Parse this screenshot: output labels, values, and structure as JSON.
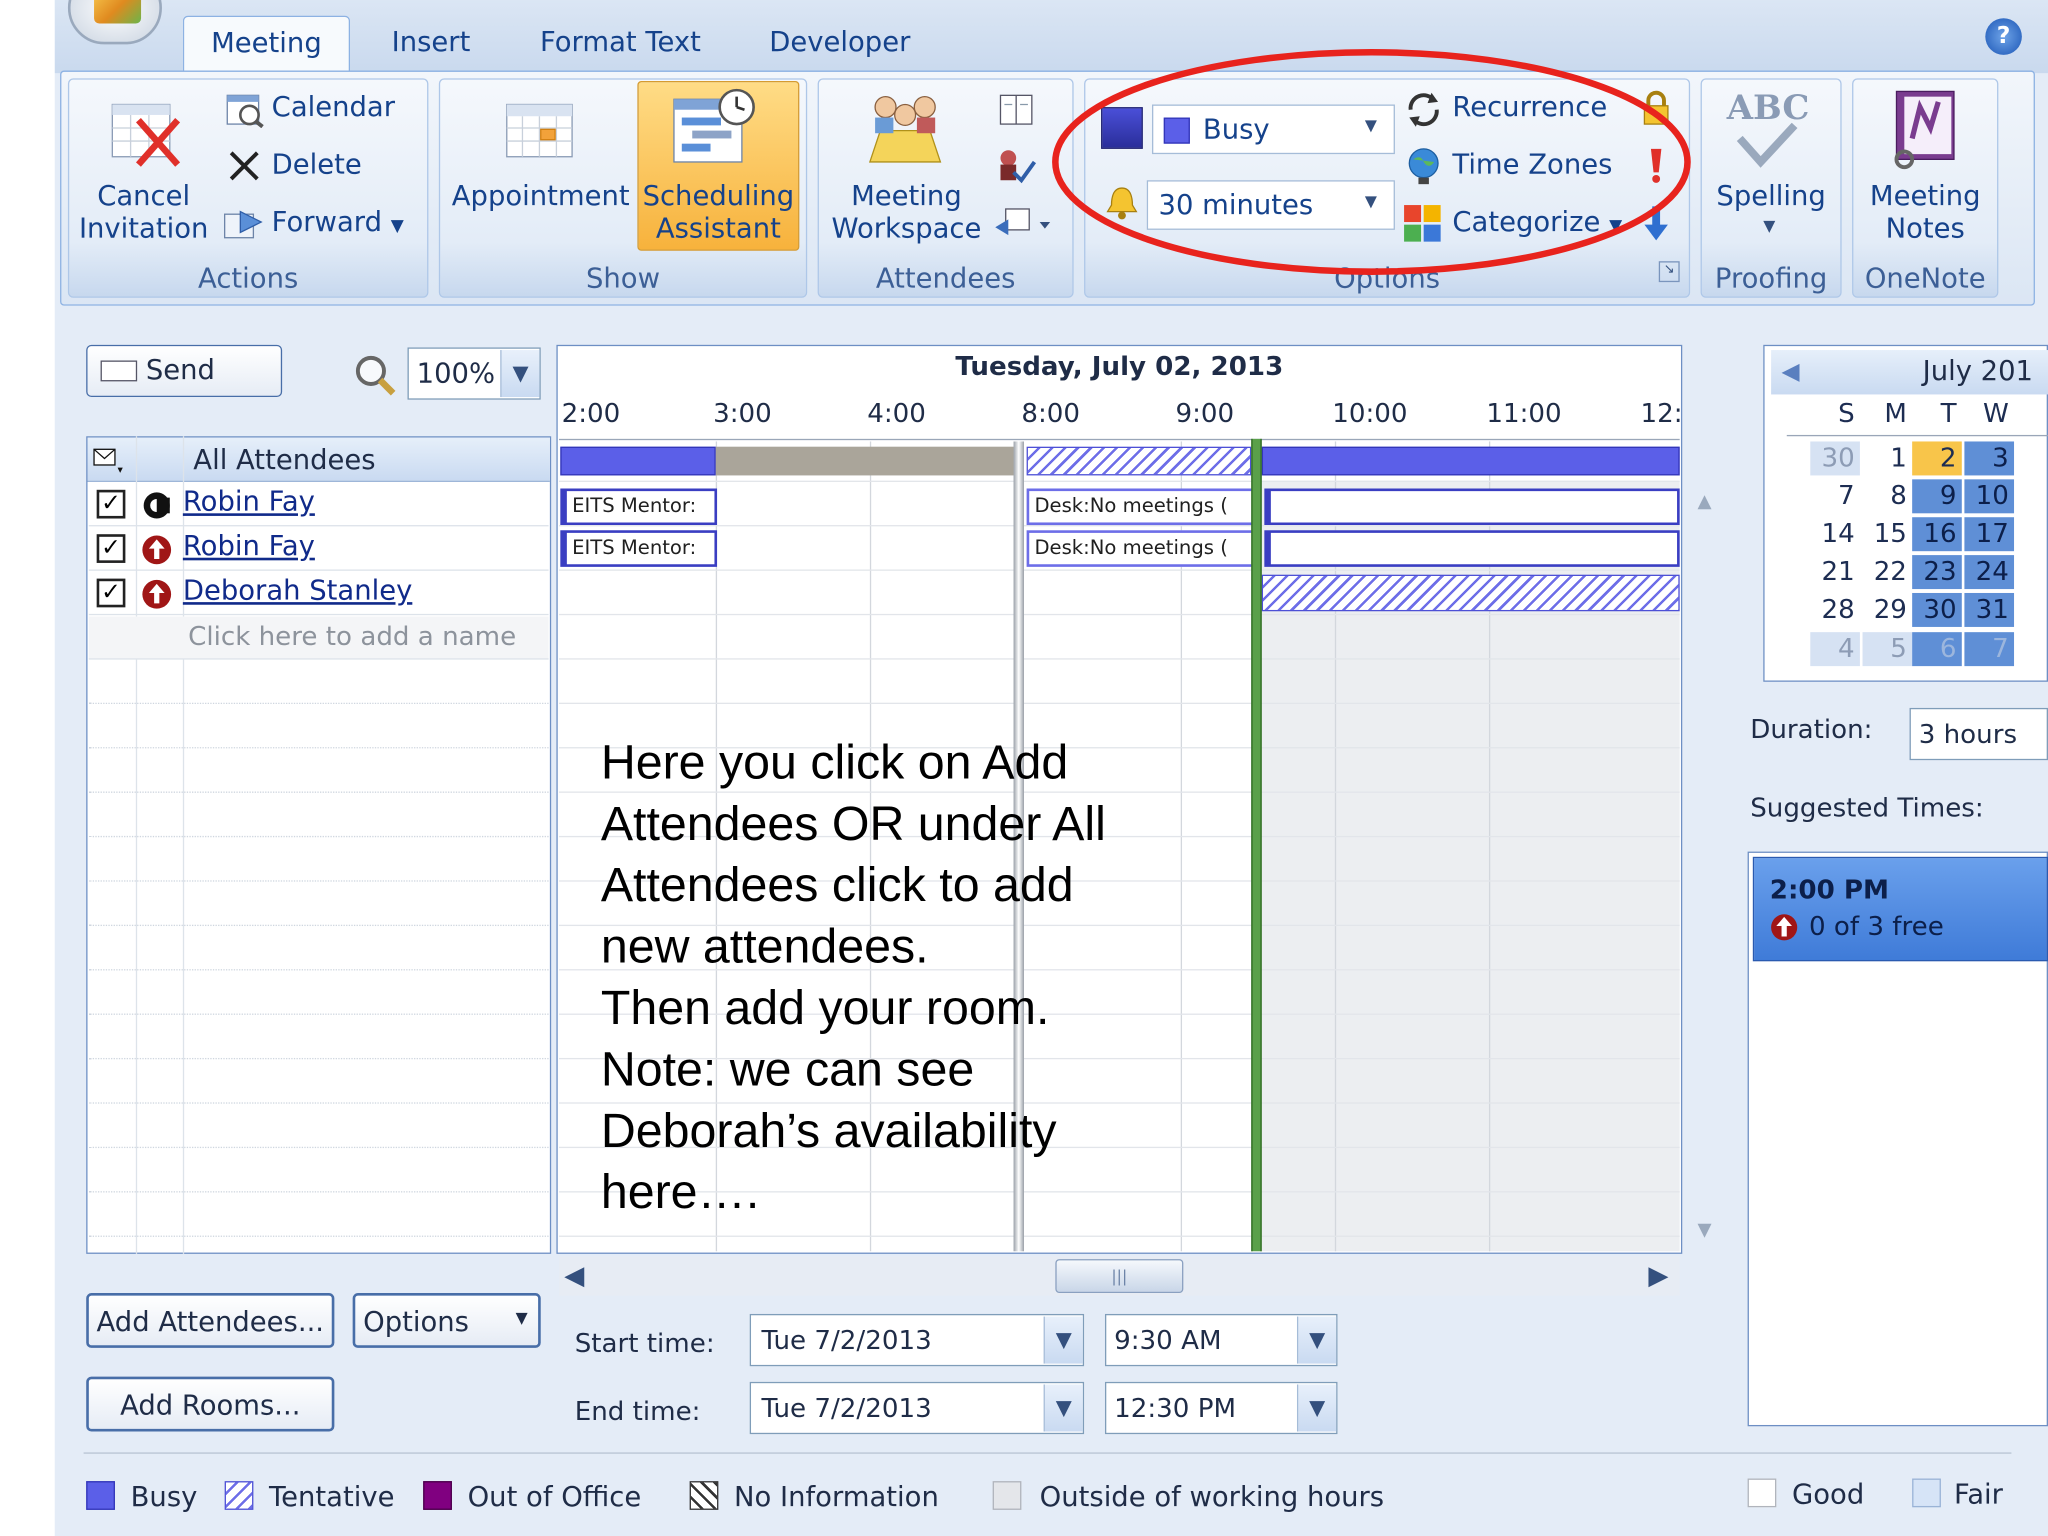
{
  "tabs": [
    "Meeting",
    "Insert",
    "Format Text",
    "Developer"
  ],
  "groups": {
    "actions": {
      "label": "Actions",
      "cancel_line1": "Cancel",
      "cancel_line2": "Invitation",
      "calendar": "Calendar",
      "delete": "Delete",
      "forward": "Forward"
    },
    "show": {
      "label": "Show",
      "appointment": "Appointment",
      "sched_line1": "Scheduling",
      "sched_line2": "Assistant"
    },
    "attendees": {
      "label": "Attendees",
      "workspace_line1": "Meeting",
      "workspace_line2": "Workspace"
    },
    "options": {
      "label": "Options",
      "show_as": "Busy",
      "reminder": "30 minutes",
      "recurrence": "Recurrence",
      "time_zones": "Time Zones",
      "categorize": "Categorize"
    },
    "proofing": {
      "label": "Proofing",
      "spelling": "Spelling",
      "abc": "ABC"
    },
    "onenote": {
      "label": "OneNote",
      "notes_line1": "Meeting",
      "notes_line2": "Notes"
    }
  },
  "toolbar": {
    "send": "Send",
    "zoom": "100%"
  },
  "schedule": {
    "date": "Tuesday, July 02, 2013",
    "hours": [
      "2:00",
      "3:00",
      "4:00",
      "8:00",
      "9:00",
      "10:00",
      "11:00",
      "12:"
    ],
    "events": [
      "EITS Mentor:",
      "EITS Mentor:",
      "Desk:No meetings (",
      "Desk:No meetings ("
    ]
  },
  "attendees": {
    "header": "All Attendees",
    "rows": [
      "Robin Fay",
      "Robin Fay",
      "Deborah Stanley"
    ],
    "add_placeholder": "Click here to add a name"
  },
  "annotation": {
    "lines": [
      "Here you click on Add",
      "Attendees OR under All",
      "Attendees click to add",
      "new attendees.",
      "Then add your room.",
      "Note: we can see",
      "Deborah’s availability",
      "here…."
    ]
  },
  "buttons": {
    "add_attendees": "Add Attendees...",
    "options": "Options",
    "add_rooms": "Add Rooms..."
  },
  "times": {
    "start_label": "Start time:",
    "start_date": "Tue 7/2/2013",
    "start_time": "9:30 AM",
    "end_label": "End time:",
    "end_date": "Tue 7/2/2013",
    "end_time": "12:30 PM"
  },
  "calendar": {
    "month": "July 201",
    "days": [
      "S",
      "M",
      "T",
      "W"
    ],
    "weeks": [
      [
        "30",
        "1",
        "2",
        "3"
      ],
      [
        "7",
        "8",
        "9",
        "10"
      ],
      [
        "14",
        "15",
        "16",
        "17"
      ],
      [
        "21",
        "22",
        "23",
        "24"
      ],
      [
        "28",
        "29",
        "30",
        "31"
      ],
      [
        "4",
        "5",
        "6",
        "7"
      ]
    ]
  },
  "duration": {
    "label": "Duration:",
    "value": "3 hours"
  },
  "suggested": {
    "label": "Suggested Times:",
    "time": "2:00 PM",
    "free": "0 of 3 free"
  },
  "legend": [
    "Busy",
    "Tentative",
    "Out of Office",
    "No Information",
    "Outside of working hours",
    "Good",
    "Fair"
  ],
  "colors": {
    "busy": "#5b5fe8",
    "out_of_office": "#800080",
    "highlight": "#e8231d",
    "selected_day": "#f8c54a",
    "suggested_bg": "#4a86e8"
  }
}
